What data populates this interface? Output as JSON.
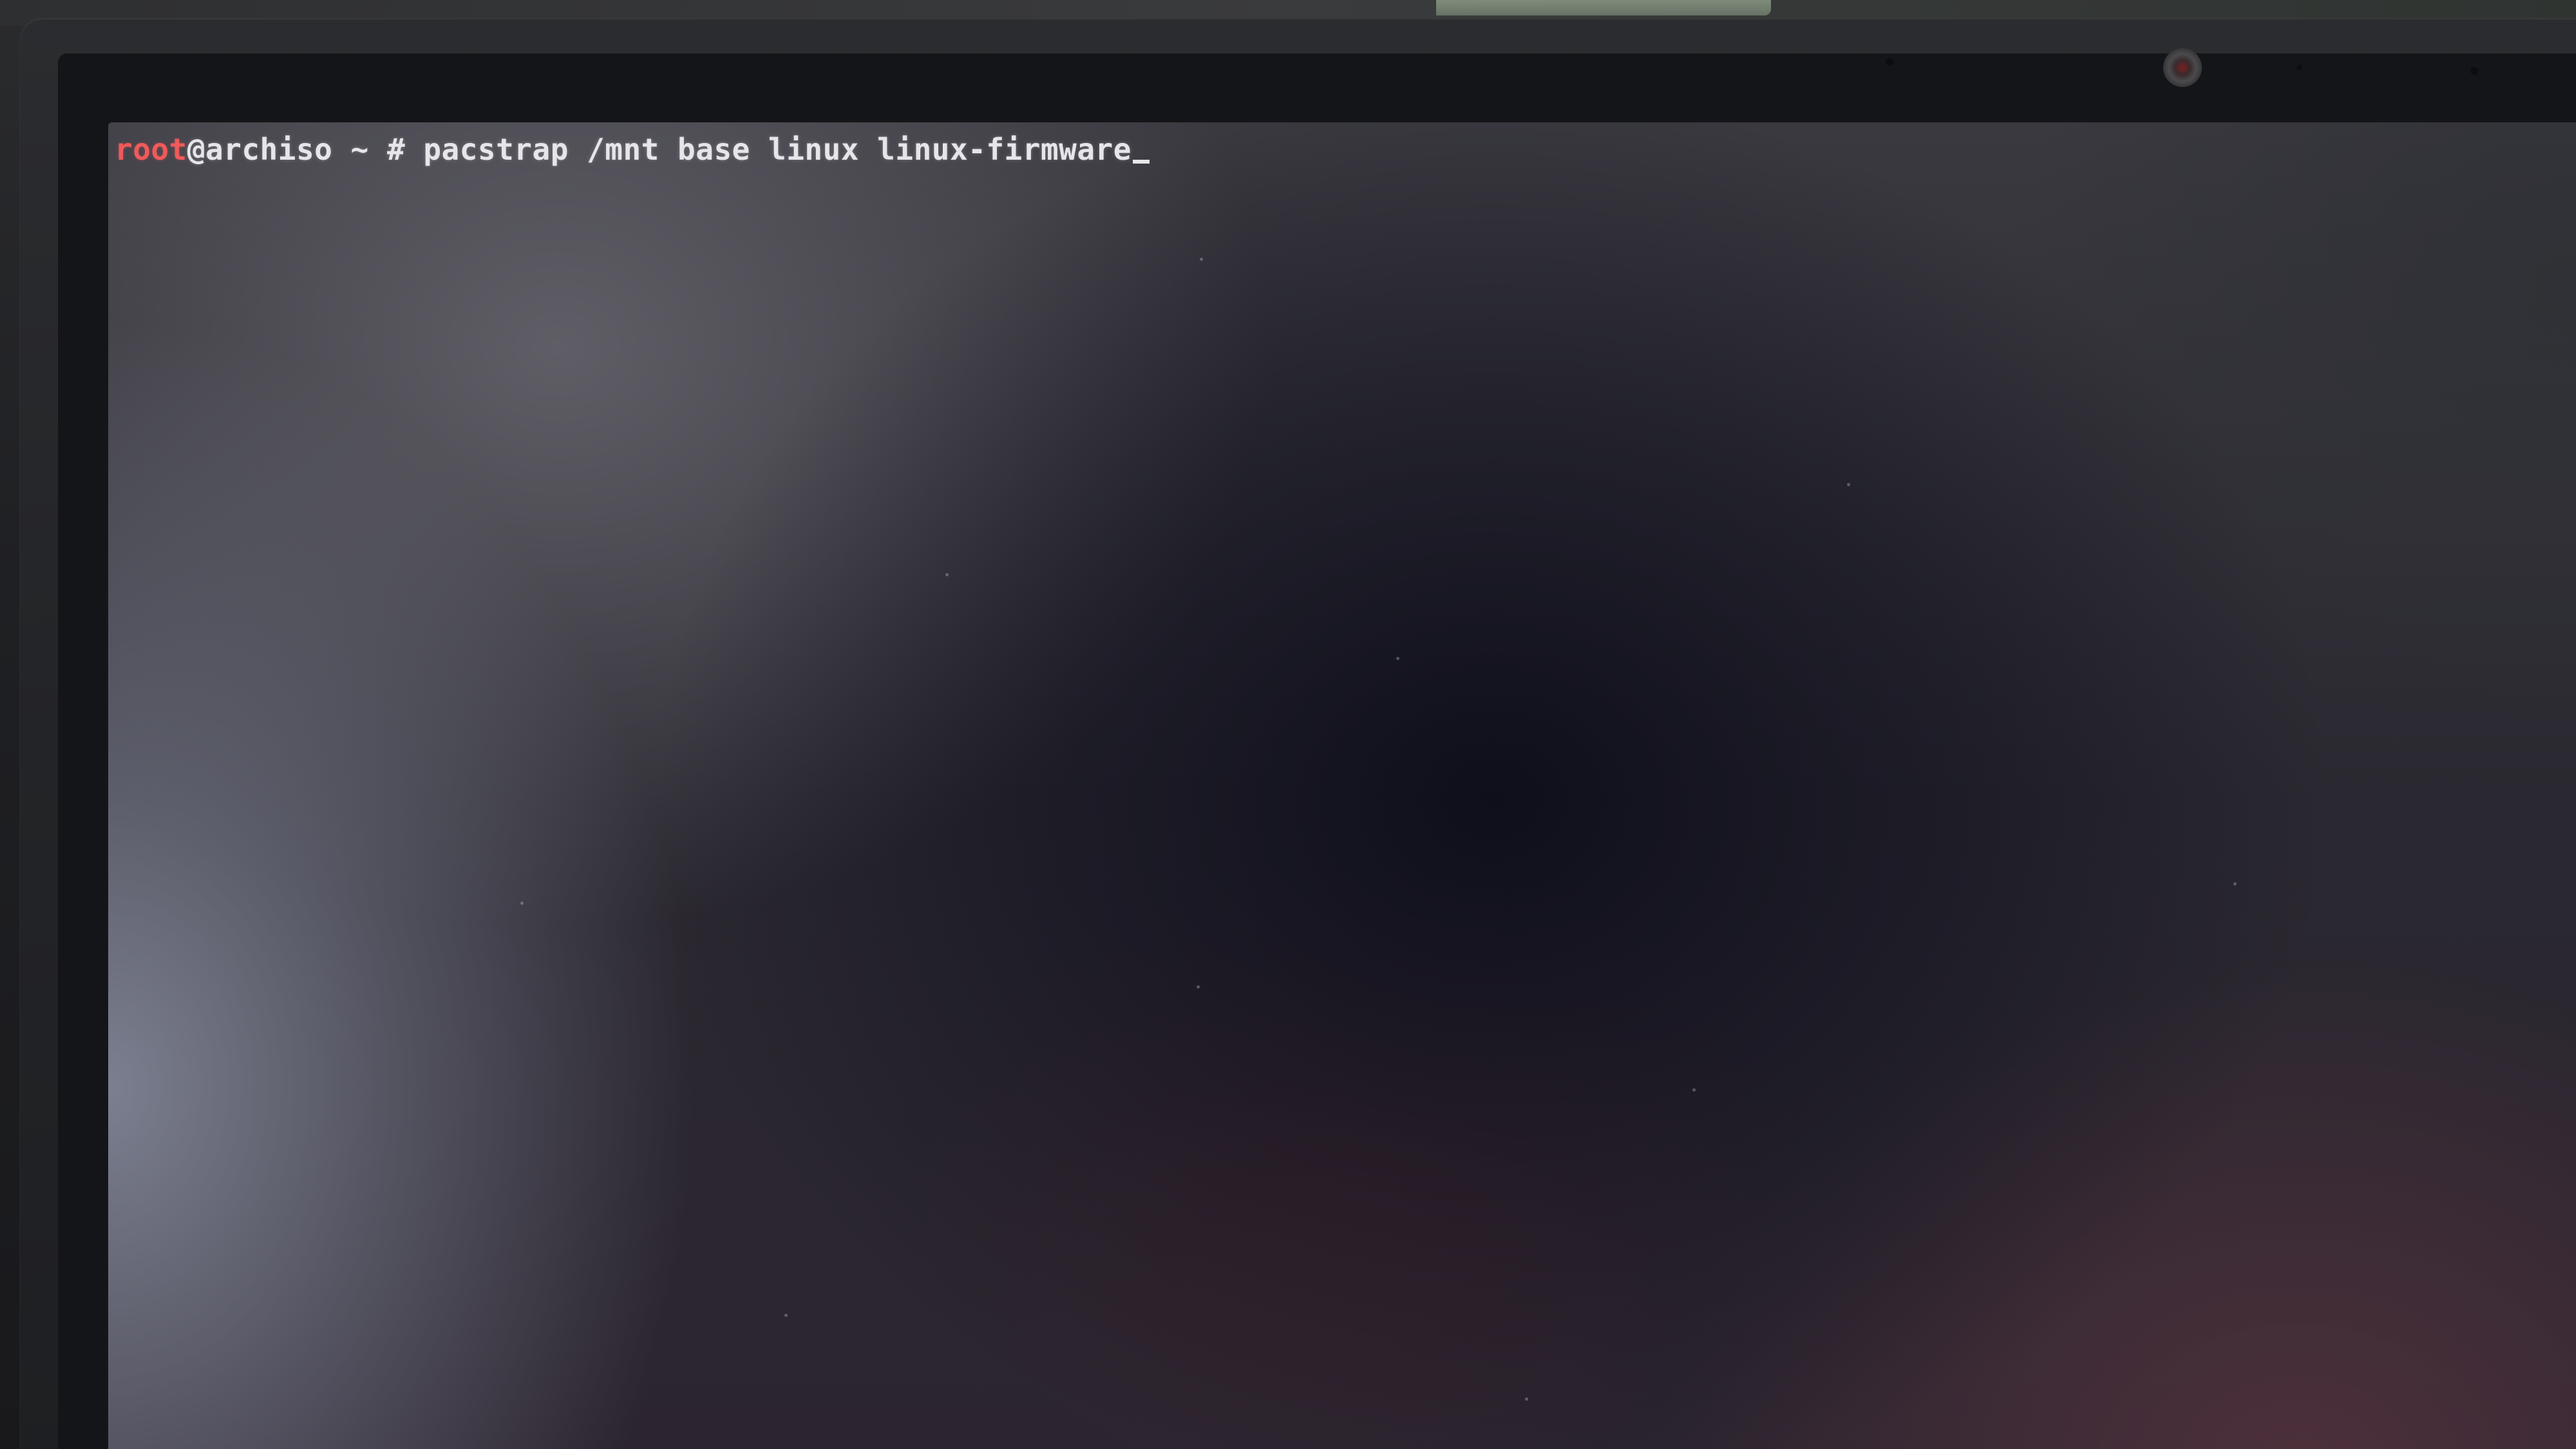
{
  "terminal": {
    "prompt_user": "root",
    "prompt_host": "@archiso",
    "prompt_dir": " ~ ",
    "prompt_symbol": "# ",
    "command": "pacstrap /mnt base linux linux-firmware"
  },
  "colors": {
    "prompt_user": "#f05a5a",
    "text": "#e6e6ea"
  }
}
